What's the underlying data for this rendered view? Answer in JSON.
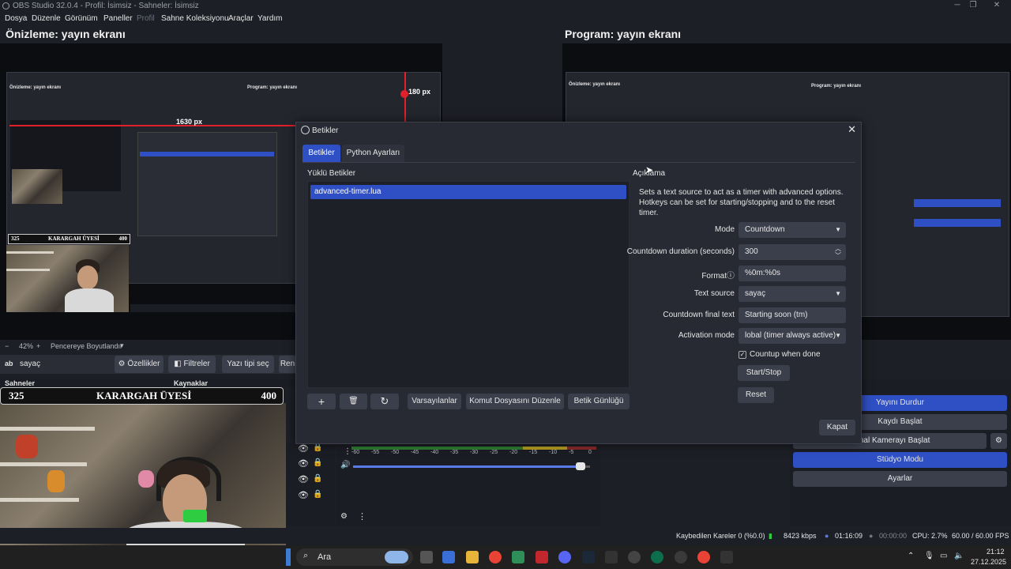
{
  "window": {
    "title": "OBS Studio 32.0.4 - Profil: İsimsiz - Sahneler: İsimsiz"
  },
  "menu": {
    "items": [
      "Dosya",
      "Düzenle",
      "Görünüm",
      "Paneller",
      "Profil",
      "Sahne Koleksiyonu",
      "Araçlar",
      "Yardım"
    ]
  },
  "preview": {
    "title": "Önizleme: yayın ekranı",
    "measure_h": "1630 px",
    "measure_v": "180 px",
    "zoom": "42%",
    "fit_label": "Pencereye Boyutlandır"
  },
  "program": {
    "title": "Program: yayın ekranı"
  },
  "source_bar": {
    "source_name": "sayaç",
    "properties": "Özellikler",
    "filters": "Filtreler",
    "font": "Yazı tipi seç",
    "rename_partial": "Ren"
  },
  "docks": {
    "scenes": "Sahneler",
    "sources": "Kaynaklar"
  },
  "banner": {
    "left": "325",
    "center": "KARARGAH ÜYESİ",
    "right": "400"
  },
  "audio": {
    "ticks": [
      "-60",
      "-55",
      "-50",
      "-45",
      "-40",
      "-35",
      "-30",
      "-25",
      "-20",
      "-15",
      "-10",
      "-5",
      "0"
    ],
    "volume_level": 0.96
  },
  "controls": {
    "stop_stream": "Yayını Durdur",
    "start_record": "Kaydı Başlat",
    "virtual_cam": "Sanal Kamerayı Başlat",
    "studio_mode": "Stüdyo Modu",
    "settings": "Ayarlar"
  },
  "status": {
    "dropped": "Kaybedilen Kareler 0 (%0.0)",
    "bitrate": "8423 kbps",
    "stream_time": "01:16:09",
    "rec_time": "00:00:00",
    "cpu": "CPU: 2.7%",
    "fps": "60.00 / 60.00 FPS"
  },
  "taskbar": {
    "search": "Ara",
    "time": "21:12",
    "date": "27.12.2025"
  },
  "dialog": {
    "title": "Betikler",
    "tabs": [
      "Betikler",
      "Python Ayarları"
    ],
    "loaded_label": "Yüklü Betikler",
    "scripts": [
      "advanced-timer.lua"
    ],
    "desc_label": "Açıklama",
    "description": "Sets a text source to act as a timer with advanced options. Hotkeys can be set for starting/stopping and to the reset timer.",
    "buttons": {
      "defaults": "Varsayılanlar",
      "edit": "Komut Dosyasını Düzenle",
      "log": "Betik Günlüğü",
      "close": "Kapat"
    },
    "props": {
      "mode_label": "Mode",
      "mode_value": "Countdown",
      "duration_label": "Countdown duration (seconds)",
      "duration_value": "300",
      "format_label": "Format",
      "format_value": "%0m:%0s",
      "text_source_label": "Text source",
      "text_source_value": "sayaç",
      "final_text_label": "Countdown final text",
      "final_text_value": "Starting soon (tm)",
      "activation_label": "Activation mode",
      "activation_value": "lobal (timer always active)",
      "countup_label": "Countup when done",
      "start_stop": "Start/Stop",
      "reset": "Reset"
    }
  }
}
